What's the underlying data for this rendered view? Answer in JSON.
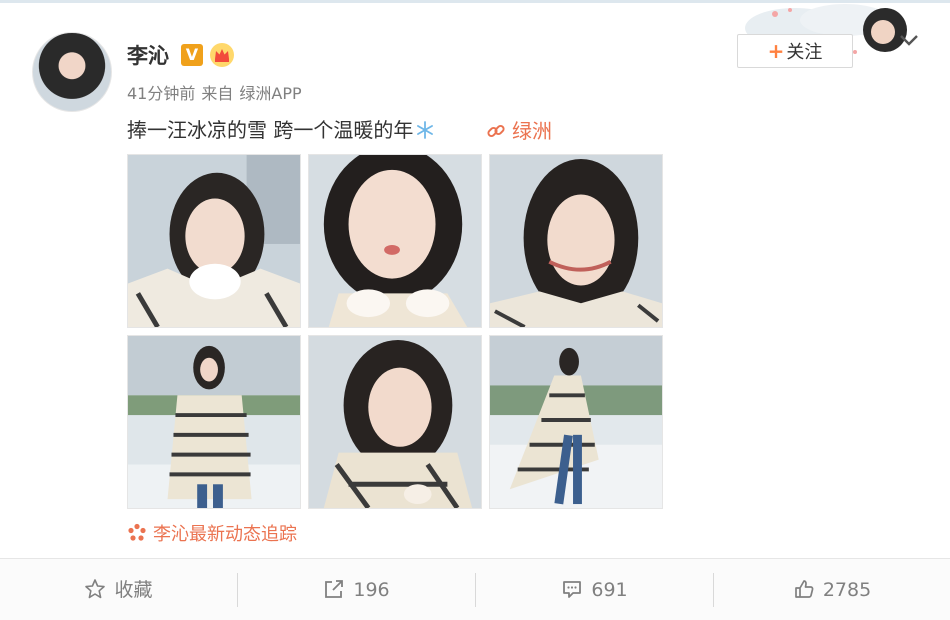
{
  "post": {
    "username": "李沁",
    "verified_badge": "V",
    "time_ago": "41分钟前",
    "source_label": "来自",
    "source_app": "绿洲APP",
    "text": "捧一汪冰凉的雪 跨一个温暖的年",
    "link_label": "绿洲",
    "topic_label": "李沁最新动态追踪",
    "follow_label": "关注",
    "photo_count": 6
  },
  "actions": {
    "favorite_label": "收藏",
    "repost_count": "196",
    "comment_count": "691",
    "like_count": "2785"
  },
  "colors": {
    "accent": "#eb7350",
    "follow_plus": "#ff8140",
    "text": "#333333",
    "muted": "#808080",
    "badge": "#f0a11b"
  },
  "icons": [
    "snowflake-icon",
    "link-icon",
    "flower-icon",
    "star-icon",
    "share-icon",
    "comment-icon",
    "thumbs-up-icon",
    "chevron-down-icon",
    "crown-icon"
  ]
}
